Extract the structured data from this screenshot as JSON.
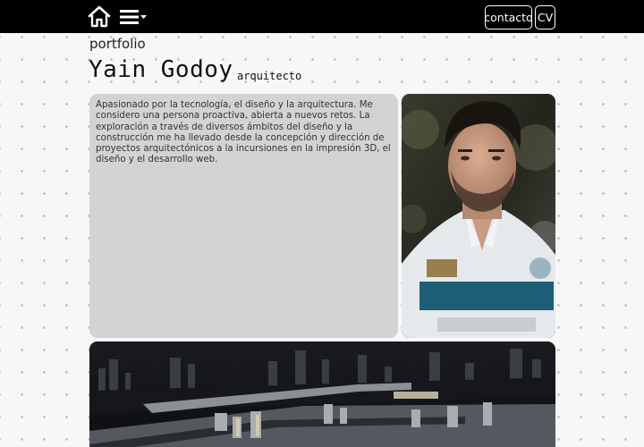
{
  "nav": {
    "home_icon": "home-icon",
    "menu_icon": "hamburger-menu-icon",
    "contact_label": "contacto",
    "cv_label": "CV"
  },
  "header": {
    "kicker": "portfolio",
    "name": "Yain Godoy",
    "role": "arquitecto"
  },
  "bio": {
    "text": "Apasionado por la tecnología, el diseño y la arquitectura. Me considero una persona proactiva, abierta a nuevos retos. La exploración a través de diversos ámbitos del diseño y la construcción me ha llevado desde la concepción y dirección de proyectos arquitectónicos a la incursiones en la impresión 3D, el diseño y el desarrollo web."
  },
  "colors": {
    "topbar": "#000000",
    "card": "#d3d3d3",
    "background": "#f7f7f7"
  }
}
